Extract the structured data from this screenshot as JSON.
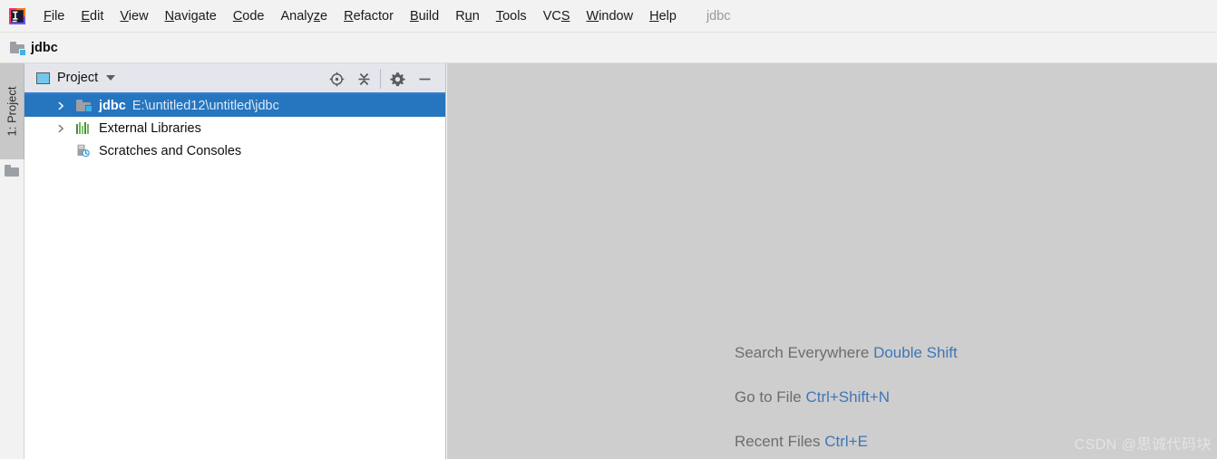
{
  "app": {
    "logo_icon": "intellij-idea-logo",
    "project_name_label": "jdbc"
  },
  "menubar": {
    "items": [
      {
        "label": "File",
        "mnemonic_index": 0
      },
      {
        "label": "Edit",
        "mnemonic_index": 0
      },
      {
        "label": "View",
        "mnemonic_index": 0
      },
      {
        "label": "Navigate",
        "mnemonic_index": 0
      },
      {
        "label": "Code",
        "mnemonic_index": 0
      },
      {
        "label": "Analyze",
        "mnemonic_index": 5
      },
      {
        "label": "Refactor",
        "mnemonic_index": 0
      },
      {
        "label": "Build",
        "mnemonic_index": 0
      },
      {
        "label": "Run",
        "mnemonic_index": 1
      },
      {
        "label": "Tools",
        "mnemonic_index": 0
      },
      {
        "label": "VCS",
        "mnemonic_index": 2
      },
      {
        "label": "Window",
        "mnemonic_index": 0
      },
      {
        "label": "Help",
        "mnemonic_index": 0
      }
    ]
  },
  "navbar": {
    "crumb_icon": "folder-icon",
    "crumb_label": "jdbc"
  },
  "toolstrip": {
    "project_button_label": "1: Project",
    "folder_icon": "folder-icon"
  },
  "project_panel": {
    "tab_icon": "project-view-icon",
    "tab_label": "Project",
    "dropdown_icon": "chevron-down-icon",
    "actions": [
      {
        "name": "scroll-from-source-icon",
        "title": "Select Opened File"
      },
      {
        "name": "collapse-all-icon",
        "title": "Collapse All"
      },
      {
        "name": "settings-gear-icon",
        "title": "Settings"
      },
      {
        "name": "hide-panel-icon",
        "title": "Hide"
      }
    ],
    "tree": [
      {
        "label": "jdbc",
        "path": "E:\\untitled12\\untitled\\jdbc",
        "icon": "project-folder-icon",
        "expander": "chevron-right-icon",
        "selected": true,
        "level": 0
      },
      {
        "label": "External Libraries",
        "path": "",
        "icon": "library-icon",
        "expander": "chevron-right-icon",
        "selected": false,
        "level": 0
      },
      {
        "label": "Scratches and Consoles",
        "path": "",
        "icon": "scratches-icon",
        "expander": "",
        "selected": false,
        "level": 1
      }
    ]
  },
  "editor": {
    "hints": [
      {
        "action": "Search Everywhere",
        "key": "Double Shift"
      },
      {
        "action": "Go to File",
        "key": "Ctrl+Shift+N"
      },
      {
        "action": "Recent Files",
        "key": "Ctrl+E"
      }
    ],
    "watermark": "CSDN @思诚代码块"
  },
  "colors": {
    "selection_blue": "#2675bf",
    "hint_key_blue": "#3f76b8",
    "hint_action_gray": "#6d6d6d",
    "editor_bg": "#cecece",
    "panel_header_bg": "#e4e6ec",
    "accent_underline": "#3a7fd0"
  }
}
